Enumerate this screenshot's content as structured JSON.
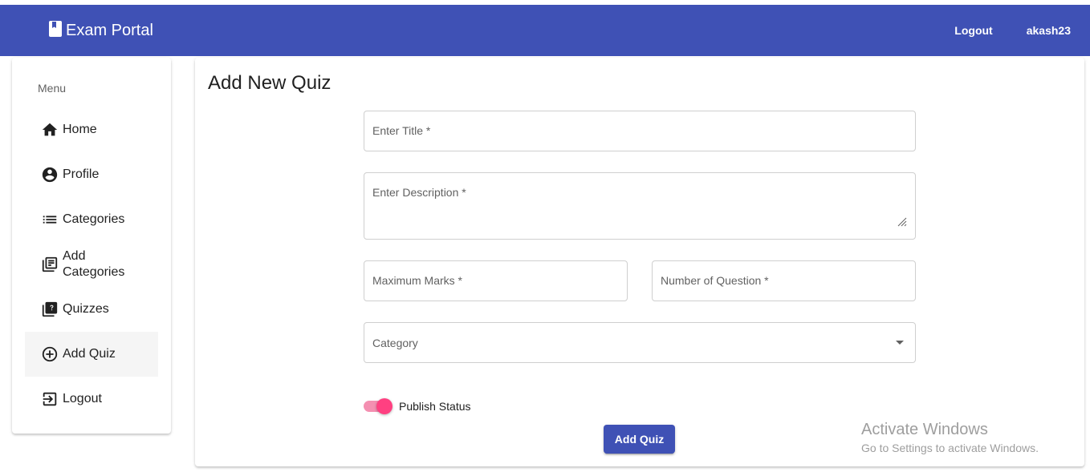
{
  "header": {
    "title": "Exam Portal",
    "nav": {
      "logout": "Logout",
      "username": "akash23"
    }
  },
  "sidebar": {
    "heading": "Menu",
    "items": [
      {
        "label": "Home",
        "icon": "home-icon"
      },
      {
        "label": "Profile",
        "icon": "account-circle-icon"
      },
      {
        "label": "Categories",
        "icon": "list-icon"
      },
      {
        "label": "Add Categories",
        "icon": "library-books-icon"
      },
      {
        "label": "Quizzes",
        "icon": "quiz-icon"
      },
      {
        "label": "Add Quiz",
        "icon": "add-circle-icon",
        "active": true
      },
      {
        "label": "Logout",
        "icon": "exit-to-app-icon"
      }
    ]
  },
  "main": {
    "title": "Add New Quiz",
    "form": {
      "title_placeholder": "Enter Title *",
      "description_placeholder": "Enter Description *",
      "max_marks_placeholder": "Maximum Marks *",
      "num_questions_placeholder": "Number of Question *",
      "category_placeholder": "Category",
      "publish_label": "Publish Status",
      "publish_on": true,
      "submit_label": "Add Quiz"
    }
  },
  "watermark": {
    "line1": "Activate Windows",
    "line2": "Go to Settings to activate Windows."
  },
  "colors": {
    "primary": "#3f51b5",
    "accent": "#ff4081"
  }
}
